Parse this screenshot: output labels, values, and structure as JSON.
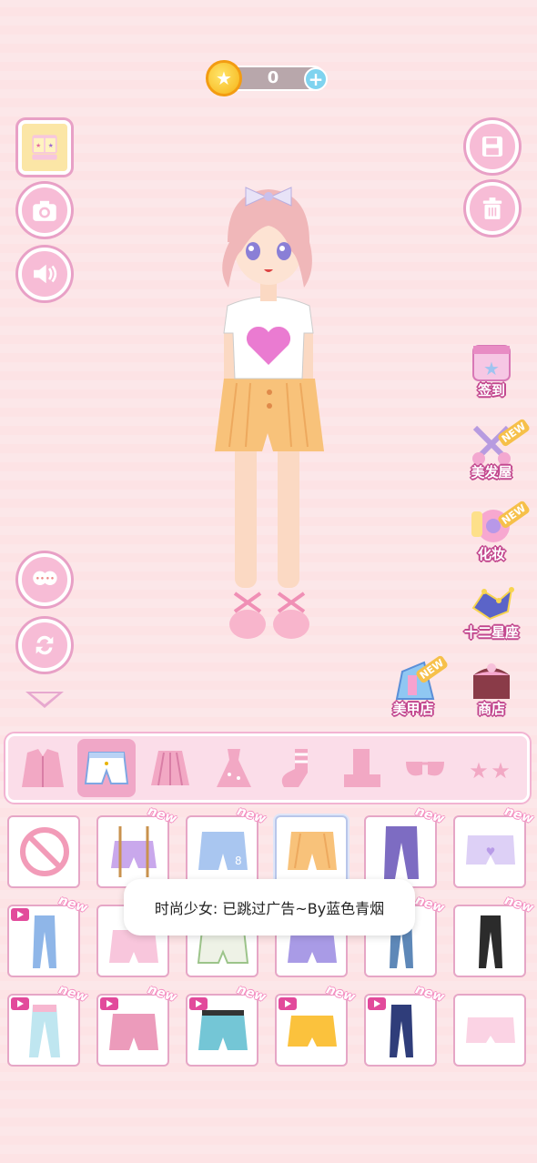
{
  "currency": {
    "value": "0",
    "icon": "star-coin-icon",
    "add_icon": "plus-icon"
  },
  "left_buttons": [
    "wardrobe-icon",
    "camera-icon",
    "speaker-icon",
    "swap-face-icon",
    "refresh-icon"
  ],
  "right_buttons": [
    "save-icon",
    "trash-icon"
  ],
  "features": [
    {
      "label": "签到",
      "icon": "calendar-star-icon",
      "new": false
    },
    {
      "label": "美发屋",
      "icon": "scissors-icon",
      "new": true
    },
    {
      "label": "化妆",
      "icon": "makeup-palette-icon",
      "new": true
    },
    {
      "label": "十二星座",
      "icon": "constellation-icon",
      "new": false
    },
    {
      "label": "美甲店",
      "icon": "nail-polish-icon",
      "new": true
    },
    {
      "label": "商店",
      "icon": "shop-icon",
      "new": false
    }
  ],
  "categories": [
    "jacket",
    "shorts",
    "skirt",
    "dress",
    "socks",
    "boots",
    "glasses",
    "accessory"
  ],
  "selected_category": "shorts",
  "items_rows": [
    [
      {
        "kind": "none",
        "new": false,
        "video": false
      },
      {
        "kind": "purple-overalls",
        "new": true,
        "video": false
      },
      {
        "kind": "blue-shorts",
        "new": true,
        "video": false
      },
      {
        "kind": "orange-shorts",
        "new": false,
        "video": false,
        "selected": true
      },
      {
        "kind": "purple-jeans",
        "new": true,
        "video": false
      },
      {
        "kind": "lavender-shorts",
        "new": true,
        "video": false
      }
    ],
    [
      {
        "kind": "blue-jeans",
        "new": true,
        "video": true
      },
      {
        "kind": "pink-bloomers",
        "new": false,
        "video": false
      },
      {
        "kind": "green-shorts",
        "new": false,
        "video": false
      },
      {
        "kind": "purple-shorts",
        "new": false,
        "video": false
      },
      {
        "kind": "denim-pants",
        "new": true,
        "video": false
      },
      {
        "kind": "black-pants",
        "new": true,
        "video": false
      }
    ],
    [
      {
        "kind": "pastel-pants",
        "new": true,
        "video": true
      },
      {
        "kind": "pink-shorts",
        "new": true,
        "video": true
      },
      {
        "kind": "teal-shorts",
        "new": true,
        "video": true
      },
      {
        "kind": "yellow-shorts",
        "new": true,
        "video": true
      },
      {
        "kind": "ripped-jeans",
        "new": true,
        "video": true
      },
      {
        "kind": "pink-frill-shorts",
        "new": false,
        "video": false
      }
    ]
  ],
  "new_label": "new",
  "toast": "时尚少女: 已跳过广告~By蓝色青烟"
}
